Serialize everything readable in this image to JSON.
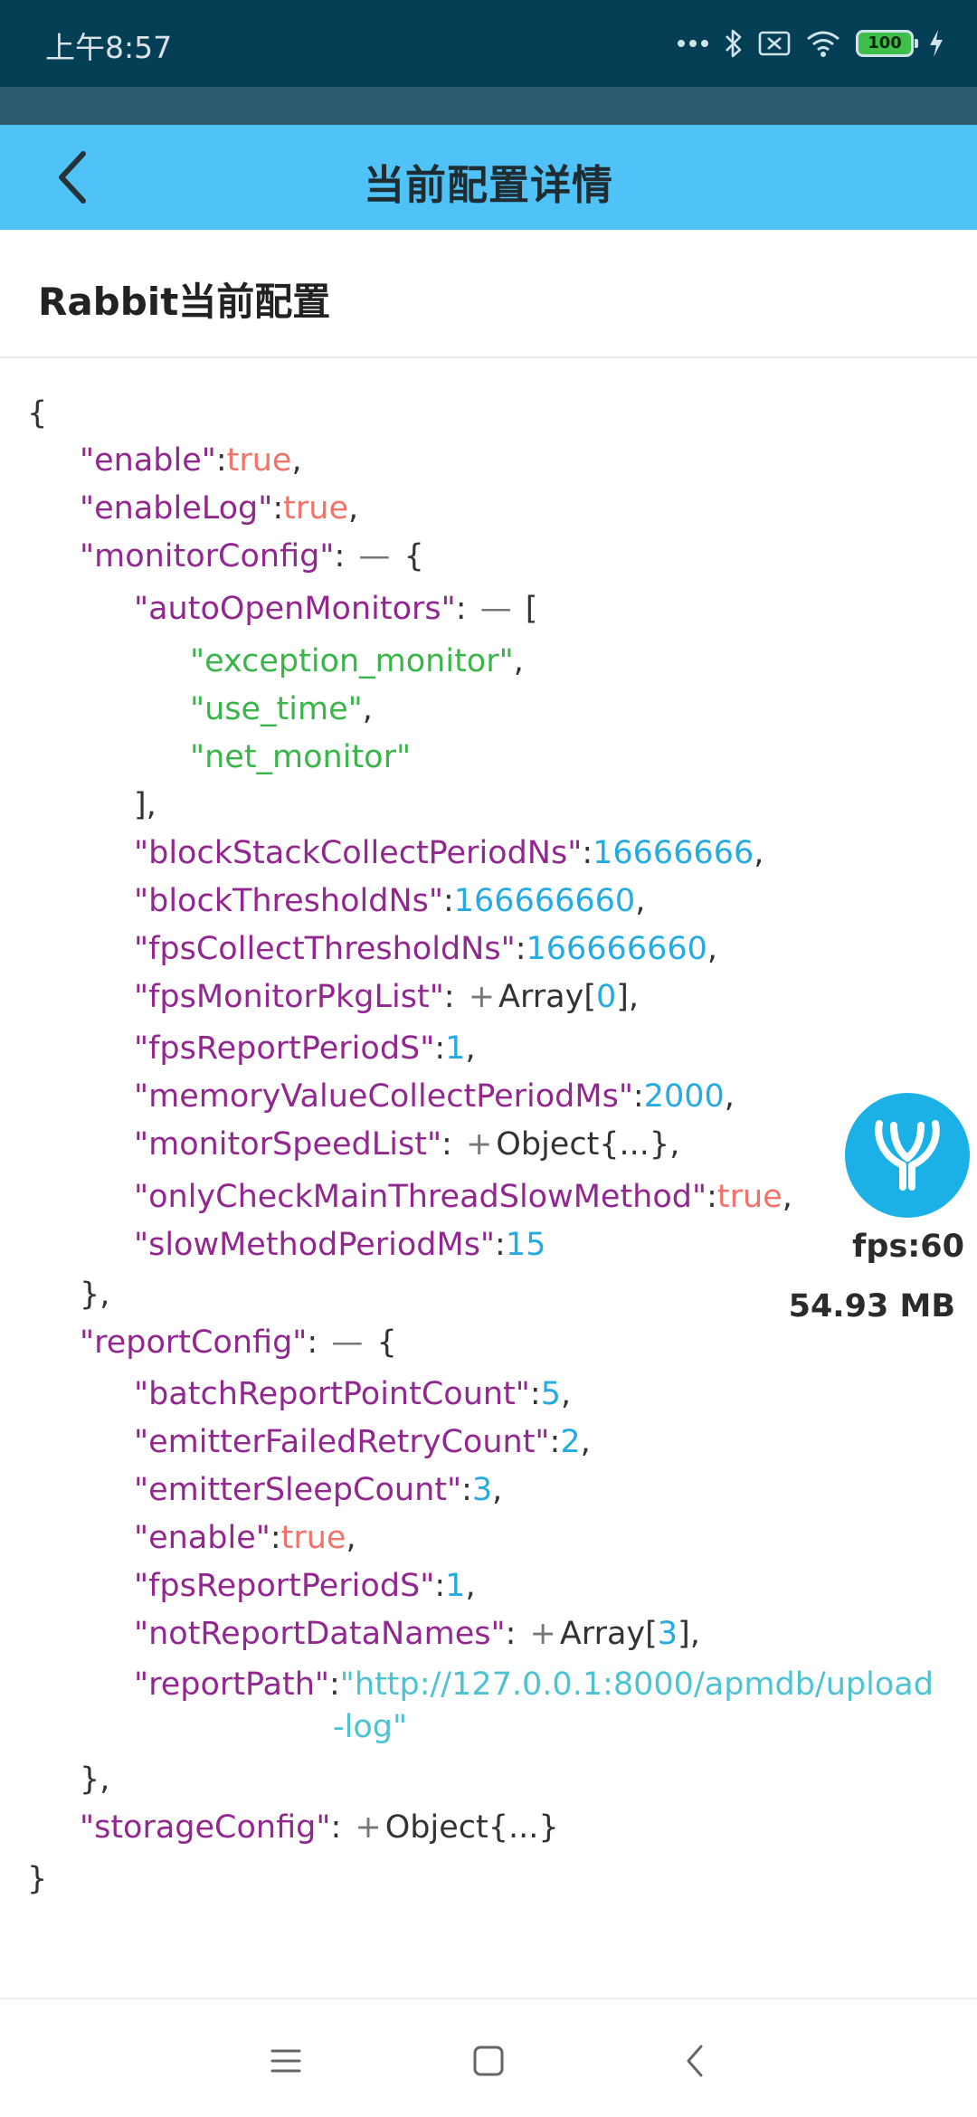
{
  "status_bar": {
    "time": "上午8:57",
    "battery": "100",
    "icons": [
      "more-dots-icon",
      "bluetooth-icon",
      "sim-off-icon",
      "wifi-icon",
      "battery-icon",
      "charging-icon"
    ]
  },
  "toolbar": {
    "title": "当前配置详情",
    "back_icon": "back-arrow-icon"
  },
  "section": {
    "title": "Rabbit当前配置"
  },
  "json": {
    "open_brace": "{",
    "close_brace": "}",
    "enable_key": "\"enable\"",
    "enable_val": "true",
    "enableLog_key": "\"enableLog\"",
    "enableLog_val": "true",
    "monitorConfig_key": "\"monitorConfig\"",
    "autoOpenMonitors_key": "\"autoOpenMonitors\"",
    "autoOpenMonitors_items": [
      "\"exception_monitor\"",
      "\"use_time\"",
      "\"net_monitor\""
    ],
    "blockStack_key": "\"blockStackCollectPeriodNs\"",
    "blockStack_val": "16666666",
    "blockThreshold_key": "\"blockThresholdNs\"",
    "blockThreshold_val": "166666660",
    "fpsCollect_key": "\"fpsCollectThresholdNs\"",
    "fpsCollect_val": "166666660",
    "fpsPkg_key": "\"fpsMonitorPkgList\"",
    "fpsPkg_type": "Array[",
    "fpsPkg_count": "0",
    "fpsReport_key": "\"fpsReportPeriodS\"",
    "fpsReport_val": "1",
    "memory_key": "\"memoryValueCollectPeriodMs\"",
    "memory_val": "2000",
    "speed_key": "\"monitorSpeedList\"",
    "speed_type": "Object{...}",
    "onlyCheck_key": "\"onlyCheckMainThreadSlowMethod\"",
    "onlyCheck_val": "true",
    "slowMethod_key": "\"slowMethodPeriodMs\"",
    "slowMethod_val": "15",
    "reportConfig_key": "\"reportConfig\"",
    "batch_key": "\"batchReportPointCount\"",
    "batch_val": "5",
    "emitterFailed_key": "\"emitterFailedRetryCount\"",
    "emitterFailed_val": "2",
    "emitterSleep_key": "\"emitterSleepCount\"",
    "emitterSleep_val": "3",
    "rc_enable_key": "\"enable\"",
    "rc_enable_val": "true",
    "rc_fpsReport_key": "\"fpsReportPeriodS\"",
    "rc_fpsReport_val": "1",
    "notReport_key": "\"notReportDataNames\"",
    "notReport_type": "Array[",
    "notReport_count": "3",
    "reportPath_key": "\"reportPath\"",
    "reportPath_val_line1": "\"http://127.0.0.1:8000/apmdb/upload",
    "reportPath_val_line2": "-log\"",
    "storage_key": "\"storageConfig\"",
    "storage_type": "Object{...}",
    "collapse_symbol": "—",
    "expand_symbol": "+"
  },
  "monitor": {
    "fps": "fps:60",
    "memory": "54.93 MB"
  },
  "nav_bar": {
    "icons": [
      "menu-icon",
      "home-square-icon",
      "back-chevron-icon"
    ]
  },
  "colors": {
    "status_bar": "#053f56",
    "toolbar": "#4fc3f7",
    "key": "#92278f",
    "boolean": "#f1736a",
    "number": "#25aae1",
    "string": "#3ab54a",
    "url": "#4dc3d2",
    "float_button": "#1bb1e6"
  }
}
